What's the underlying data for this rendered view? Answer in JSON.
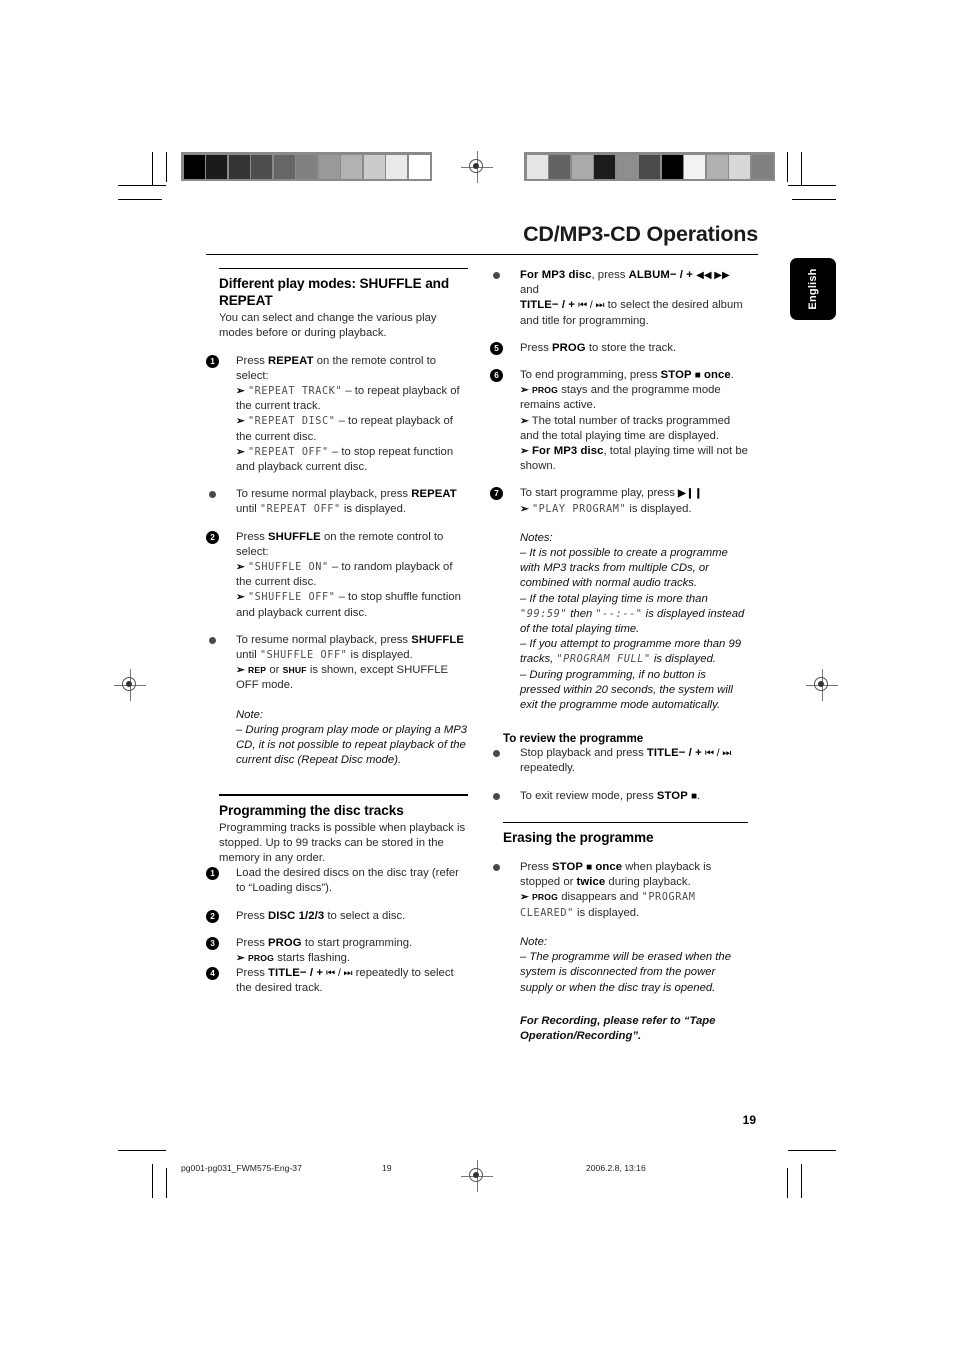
{
  "document": {
    "header_title": "CD/MP3-CD Operations",
    "language_tab": "English",
    "page_number": "19"
  },
  "footer": {
    "file": "pg001-pg031_FWM575-Eng-37",
    "page": "19",
    "date": "2006.2.8, 13:16"
  },
  "grayscale_bars": {
    "left": [
      "#000000",
      "#1b1b1b",
      "#343434",
      "#4d4d4d",
      "#666666",
      "#808080",
      "#999999",
      "#b2b2b2",
      "#cbcbcb",
      "#eaeaea",
      "#ffffff"
    ],
    "right": [
      "#e5e5e5",
      "#636363",
      "#aaaaaa",
      "#1c1c1c",
      "#8e8e8e",
      "#4a4a4a",
      "#000000",
      "#f2f2f2",
      "#b0b0b0",
      "#d8d8d8",
      "#808080"
    ]
  },
  "left_column": {
    "section1": {
      "heading": "Different play modes: SHUFFLE and REPEAT",
      "lead": "You can select and change the various play modes before or during playback.",
      "step1": {
        "marker": "1",
        "line1_pre": "Press ",
        "line1_key": "REPEAT",
        "line1_post": " on the remote control to select:",
        "a1_lcd": "\"REPEAT TRACK\"",
        "a1_text": " – to repeat playback of the current track.",
        "a2_lcd": "\"REPEAT DISC\"",
        "a2_text": " – to repeat playback of the current disc.",
        "a3_lcd": "\"REPEAT OFF\"",
        "a3_text": " – to stop repeat function and playback current disc."
      },
      "bullet1": {
        "pre": "To resume normal playback, press ",
        "key": "REPEAT",
        "mid": " until ",
        "lcd": "\"REPEAT OFF\"",
        "post": " is displayed."
      },
      "step2": {
        "marker": "2",
        "line1_pre": "Press ",
        "line1_key": "SHUFFLE",
        "line1_post": " on the remote control to select:",
        "a1_lcd": "\"SHUFFLE ON\"",
        "a1_text": " – to random playback of the current disc.",
        "a2_lcd": "\"SHUFFLE OFF\"",
        "a2_text": " – to stop shuffle function and playback current disc."
      },
      "bullet2": {
        "pre": "To resume normal playback, press ",
        "key": "SHUFFLE",
        "mid": " until ",
        "lcd": "\"SHUFFLE OFF\"",
        "post": " is displayed.",
        "arrow_key1": "REP",
        "arrow_mid": " or ",
        "arrow_key2": "SHUF",
        "arrow_post": " is shown, except SHUFFLE OFF mode."
      },
      "note_label": "Note:",
      "note_text": "–  During program play mode or playing a MP3 CD, it is not possible to repeat playback of the current disc (Repeat Disc mode)."
    },
    "section2": {
      "heading": "Programming the disc tracks",
      "lead": "Programming tracks is possible when playback is stopped. Up to 99 tracks can be stored in the memory in any order.",
      "step1": {
        "marker": "1",
        "text": "Load the desired discs on the disc tray (refer to “Loading discs”)."
      },
      "step2": {
        "marker": "2",
        "pre": "Press ",
        "key": "DISC 1/2/3",
        "post": " to select a disc."
      },
      "step3": {
        "marker": "3",
        "pre": "Press ",
        "key": "PROG",
        "post": " to start programming.",
        "arrow_key": "PROG",
        "arrow_post": " starts flashing."
      },
      "step4": {
        "marker": "4",
        "pre": "Press ",
        "key": "TITLE",
        "key_sym": "− / +",
        "glyphs": "⏮ / ⏭",
        "post": " repeatedly to select the desired track."
      }
    }
  },
  "right_column": {
    "bullet_mp3": {
      "pre": "For MP3 disc",
      "mid1": ", press ",
      "key1": "ALBUM",
      "key1_sym": "− / +",
      "glyph1": "◀◀  ▶▶",
      "mid2": " and ",
      "key2": "TITLE",
      "key2_sym": "− / +",
      "glyph2": "⏮ / ⏭",
      "post": " to select the desired album and title for programming."
    },
    "step5": {
      "marker": "5",
      "pre": "Press ",
      "key": "PROG",
      "post": " to store the track."
    },
    "step6": {
      "marker": "6",
      "pre": "To end programming, press ",
      "key": "STOP",
      "glyph": "■",
      "key2": "once",
      "post": ".",
      "a1_key": "PROG",
      "a1_text": " stays and the programme mode remains active.",
      "a2_text": "The total number of tracks programmed and the total playing time are displayed.",
      "a3_key": "For MP3 disc",
      "a3_text": ", total playing time will not be shown."
    },
    "step7": {
      "marker": "7",
      "pre": "To start programme play, press ",
      "glyph": "▶❙❙",
      "a1_lcd": "\"PLAY PROGRAM\"",
      "a1_text": " is displayed."
    },
    "notes": {
      "label": "Notes:",
      "n1": "–  It is not possible to create a programme with MP3 tracks from multiple CDs, or combined with normal audio tracks.",
      "n2_pre": "–  If the total playing time is more than ",
      "n2_lcd1": "\"99:59\"",
      "n2_mid": " then ",
      "n2_lcd2": "\"--:--\"",
      "n2_post": " is displayed instead of the total playing time.",
      "n3_pre": "–  If you attempt to programme more than 99 tracks, ",
      "n3_lcd": "\"PROGRAM FULL\"",
      "n3_post": " is displayed.",
      "n4": "–  During programming, if no button is pressed within 20 seconds, the system will exit the programme mode automatically."
    },
    "review": {
      "heading": "To review the programme",
      "pre": "Stop playback and press ",
      "key": "TITLE",
      "key_sym": "− / +",
      "glyphs": "⏮ / ⏭",
      "post": " repeatedly.",
      "exit_pre": "To exit review mode, press ",
      "exit_key": "STOP",
      "exit_glyph": "■",
      "exit_post": "."
    },
    "erasing": {
      "heading": "Erasing the programme",
      "pre": "Press ",
      "key": "STOP",
      "glyph": "■",
      "key2": "once",
      "mid": " when playback is stopped or ",
      "key3": "twice",
      "post": " during playback.",
      "a1_key": "PROG",
      "a1_mid": " disappears and ",
      "a1_lcd": "\"PROGRAM CLEARED\"",
      "a1_post": " is displayed.",
      "note_label": "Note:",
      "note_text": "–  The programme will be erased when the system is disconnected from the power supply or when the disc tray is opened.",
      "recording_note": "For Recording, please refer to “Tape Operation/Recording”."
    }
  }
}
